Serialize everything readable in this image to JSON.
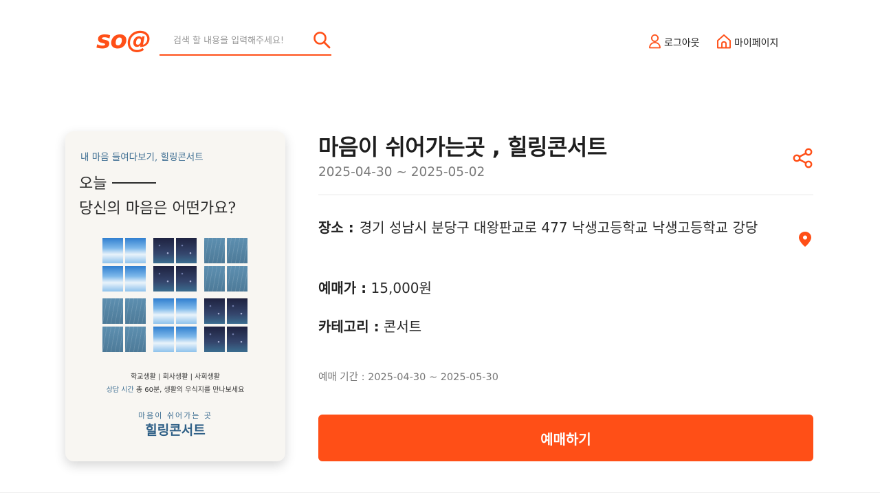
{
  "header": {
    "logo": "so@",
    "search": {
      "placeholder": "검색 할 내용을 입력해주세요!",
      "value": ""
    },
    "logout_label": "로그아웃",
    "mypage_label": "마이페이지"
  },
  "poster": {
    "subtitle": "내 마음 들여다보기, 힐링콘서트",
    "headline_1": "오늘",
    "headline_2": "당신의 마음은 어떤가요?",
    "info_line_1": "학교생활 | 회사생활 | 사회생활",
    "info_line_2_accent": "상담 시간",
    "info_line_2_rest": " 총 60분, 생활의 우식지를 만나보세요",
    "tagline": "마음이 쉬어가는 곳",
    "brand": "힐링콘서트"
  },
  "event": {
    "title": "마음이 쉬어가는곳 , 힐링콘서트",
    "period": "2025-04-30 ~ 2025-05-02",
    "place_label": "장소 :",
    "place_value": "경기 성남시 분당구 대왕판교로 477 낙생고등학교 낙생고등학교 강당",
    "price_label": "예매가 :",
    "price_value": "15,000원",
    "category_label": "카테고리 :",
    "category_value": "콘서트",
    "sale_period": "예매 기간 : 2025-04-30 ~ 2025-05-30",
    "book_label": "예매하기"
  },
  "icons": {
    "search": "search-icon",
    "user": "user-icon",
    "home": "home-icon",
    "share": "share-icon",
    "map_pin": "map-pin-icon"
  },
  "colors": {
    "accent": "#ff4f17",
    "poster_blue": "#3f6f93",
    "muted_text": "#7a7a7a"
  }
}
